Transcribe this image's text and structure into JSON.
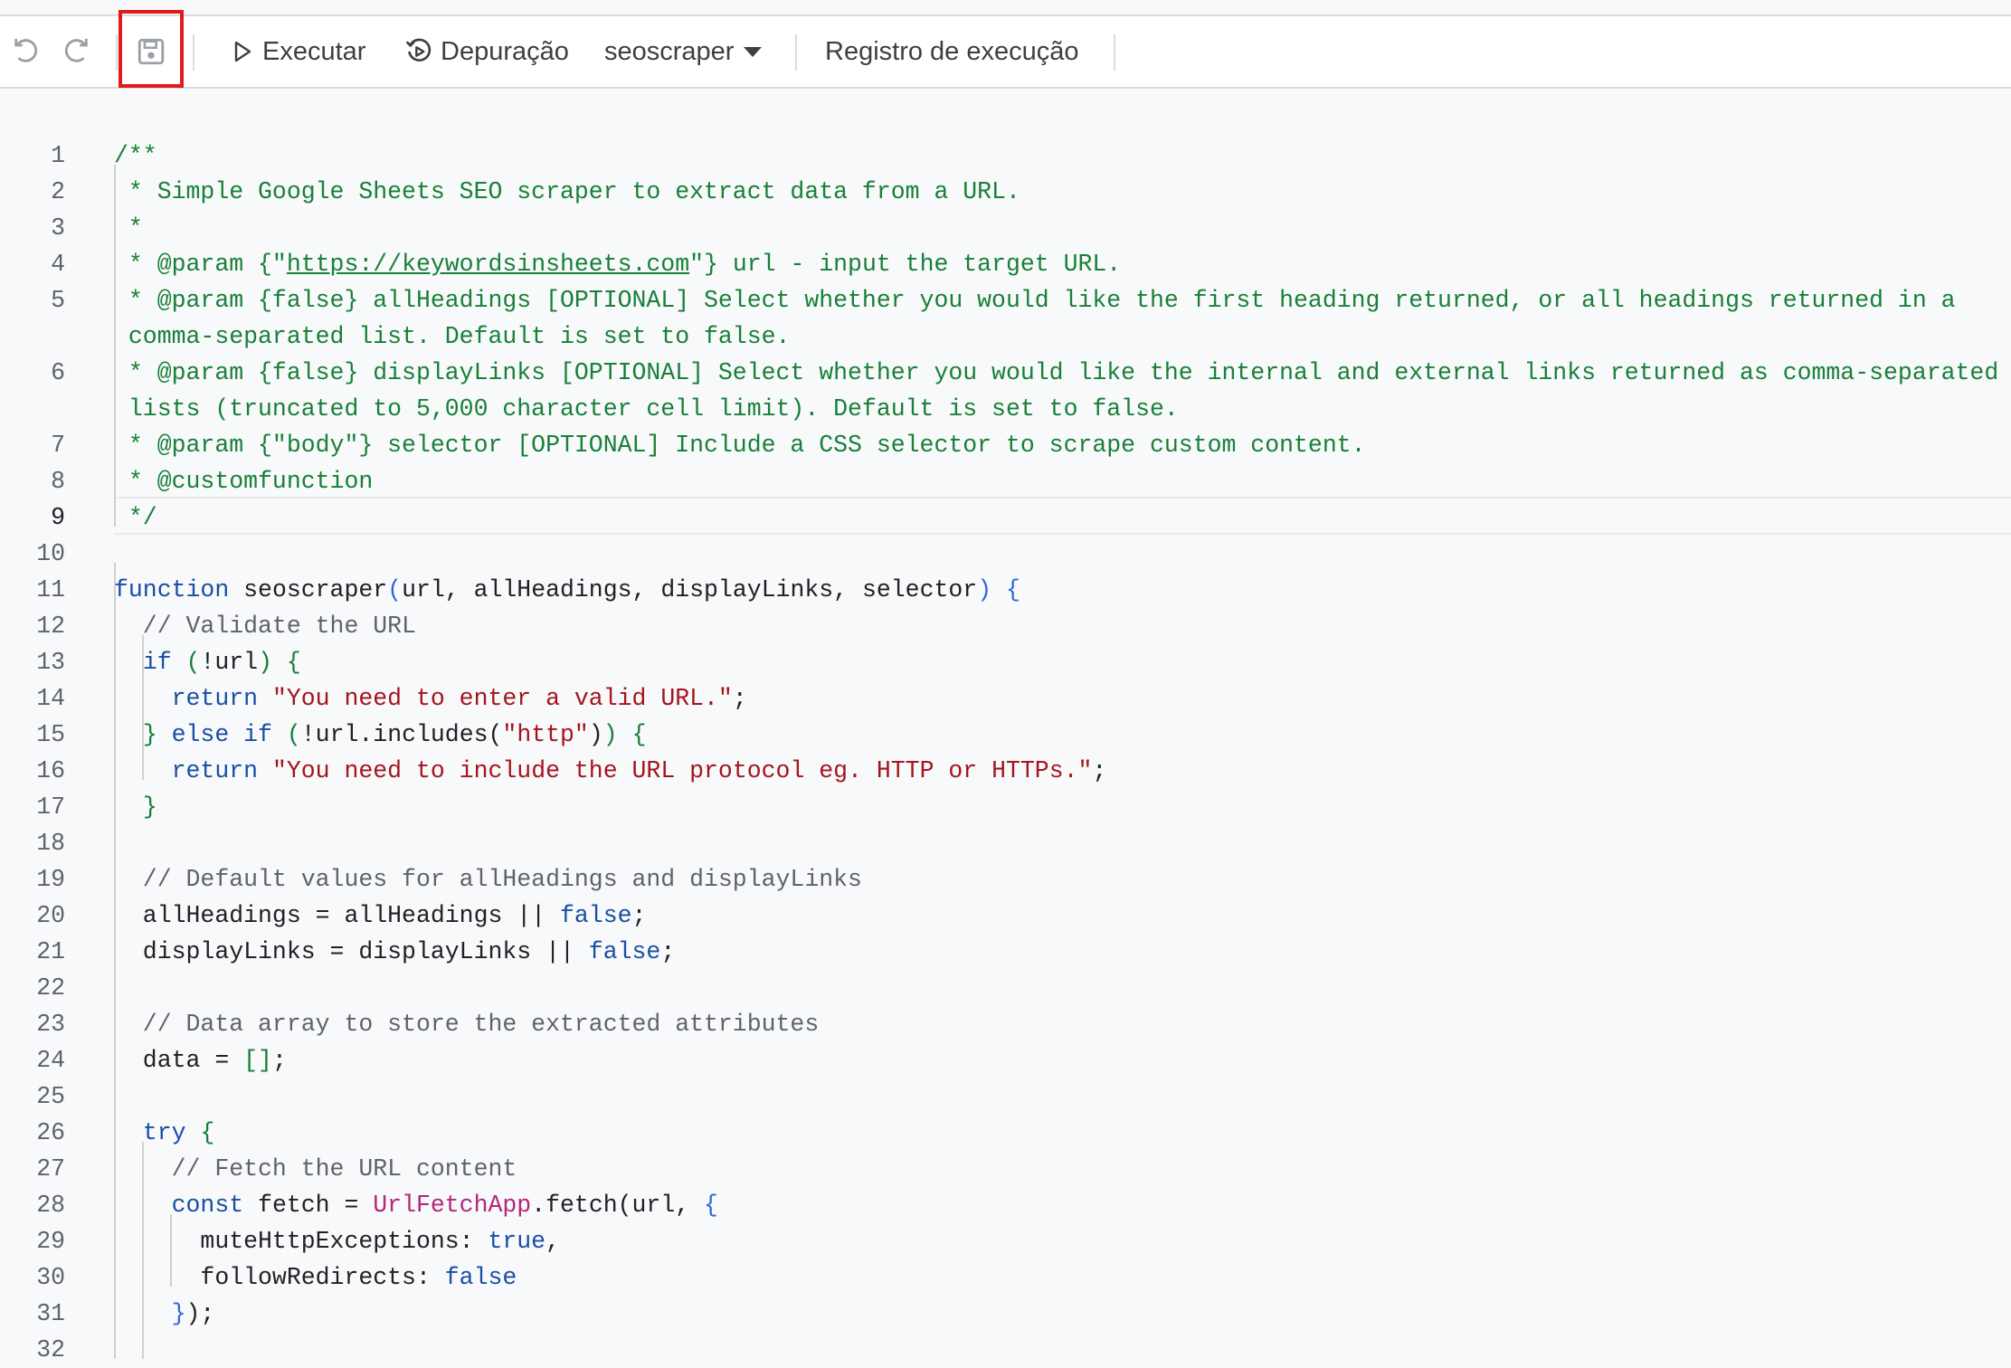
{
  "toolbar": {
    "undo_icon": "undo-icon",
    "redo_icon": "redo-icon",
    "save_icon": "save-icon",
    "run_icon": "play-icon",
    "run_label": "Executar",
    "debug_icon": "debug-icon",
    "debug_label": "Depuração",
    "function_select": {
      "value": "seoscraper",
      "icon": "caret-down-icon"
    },
    "execution_log_label": "Registro de execução"
  },
  "highlight_color": "#e21a1a",
  "editor": {
    "current_line": 9,
    "lines": [
      {
        "n": "1",
        "segs": [
          [
            "/**",
            "comment"
          ]
        ]
      },
      {
        "n": "2",
        "segs": [
          [
            " * Simple Google Sheets SEO scraper to extract data from a URL.",
            "comment"
          ]
        ]
      },
      {
        "n": "3",
        "segs": [
          [
            " *",
            "comment"
          ]
        ]
      },
      {
        "n": "4",
        "segs": [
          [
            " * @param {\"",
            "comment"
          ],
          [
            "https://keywordsinsheets.com",
            "comment-link"
          ],
          [
            "\"} url - input the target URL.",
            "comment"
          ]
        ]
      },
      {
        "n": "5",
        "segs": [
          [
            " * @param {false} allHeadings [OPTIONAL] Select whether you would like the first heading returned, or all headings returned in a",
            "comment"
          ]
        ]
      },
      {
        "n": "",
        "segs": [
          [
            " comma-separated list. Default is set to false.",
            "comment"
          ]
        ]
      },
      {
        "n": "6",
        "segs": [
          [
            " * @param {false} displayLinks [OPTIONAL] Select whether you would like the internal and external links returned as comma-separated",
            "comment"
          ]
        ]
      },
      {
        "n": "",
        "segs": [
          [
            " lists (truncated to 5,000 character cell limit). Default is set to false.",
            "comment"
          ]
        ]
      },
      {
        "n": "7",
        "segs": [
          [
            " * @param {\"body\"} selector [OPTIONAL] Include a CSS selector to scrape custom content.",
            "comment"
          ]
        ]
      },
      {
        "n": "8",
        "segs": [
          [
            " * @customfunction",
            "comment"
          ]
        ]
      },
      {
        "n": "9",
        "segs": [
          [
            " */",
            "comment"
          ]
        ]
      },
      {
        "n": "10",
        "segs": []
      },
      {
        "n": "11",
        "segs": [
          [
            "function",
            "kw"
          ],
          [
            " seoscraper",
            ""
          ],
          [
            "(",
            "br1"
          ],
          [
            "url, allHeadings, displayLinks, selector",
            ""
          ],
          [
            ")",
            "br1"
          ],
          [
            " ",
            ""
          ],
          [
            "{",
            "br1"
          ]
        ]
      },
      {
        "n": "12",
        "segs": [
          [
            "  // Validate the URL",
            "comment-sl"
          ]
        ]
      },
      {
        "n": "13",
        "segs": [
          [
            "  ",
            ""
          ],
          [
            "if",
            "kw"
          ],
          [
            " ",
            ""
          ],
          [
            "(",
            "br2"
          ],
          [
            "!url",
            ""
          ],
          [
            ")",
            "br2"
          ],
          [
            " ",
            ""
          ],
          [
            "{",
            "br2"
          ]
        ]
      },
      {
        "n": "14",
        "segs": [
          [
            "    ",
            ""
          ],
          [
            "return",
            "kw"
          ],
          [
            " ",
            ""
          ],
          [
            "\"You need to enter a valid URL.\"",
            "str"
          ],
          [
            ";",
            ""
          ]
        ]
      },
      {
        "n": "15",
        "segs": [
          [
            "  ",
            ""
          ],
          [
            "}",
            "br2"
          ],
          [
            " ",
            ""
          ],
          [
            "else",
            "kw"
          ],
          [
            " ",
            ""
          ],
          [
            "if",
            "kw"
          ],
          [
            " ",
            ""
          ],
          [
            "(",
            "br2"
          ],
          [
            "!url.includes(",
            ""
          ],
          [
            "\"http\"",
            "str"
          ],
          [
            ")",
            ""
          ],
          [
            ")",
            "br2"
          ],
          [
            " ",
            ""
          ],
          [
            "{",
            "br2"
          ]
        ]
      },
      {
        "n": "16",
        "segs": [
          [
            "    ",
            ""
          ],
          [
            "return",
            "kw"
          ],
          [
            " ",
            ""
          ],
          [
            "\"You need to include the URL protocol eg. HTTP or HTTPs.\"",
            "str"
          ],
          [
            ";",
            ""
          ]
        ]
      },
      {
        "n": "17",
        "segs": [
          [
            "  ",
            ""
          ],
          [
            "}",
            "br2"
          ]
        ]
      },
      {
        "n": "18",
        "segs": []
      },
      {
        "n": "19",
        "segs": [
          [
            "  // Default values for allHeadings and displayLinks",
            "comment-sl"
          ]
        ]
      },
      {
        "n": "20",
        "segs": [
          [
            "  allHeadings = allHeadings || ",
            ""
          ],
          [
            "false",
            "kw"
          ],
          [
            ";",
            ""
          ]
        ]
      },
      {
        "n": "21",
        "segs": [
          [
            "  displayLinks = displayLinks || ",
            ""
          ],
          [
            "false",
            "kw"
          ],
          [
            ";",
            ""
          ]
        ]
      },
      {
        "n": "22",
        "segs": []
      },
      {
        "n": "23",
        "segs": [
          [
            "  // Data array to store the extracted attributes",
            "comment-sl"
          ]
        ]
      },
      {
        "n": "24",
        "segs": [
          [
            "  data = ",
            ""
          ],
          [
            "[]",
            "br2"
          ],
          [
            ";",
            ""
          ]
        ]
      },
      {
        "n": "25",
        "segs": []
      },
      {
        "n": "26",
        "segs": [
          [
            "  ",
            ""
          ],
          [
            "try",
            "kw"
          ],
          [
            " ",
            ""
          ],
          [
            "{",
            "br2"
          ]
        ]
      },
      {
        "n": "27",
        "segs": [
          [
            "    // Fetch the URL content",
            "comment-sl"
          ]
        ]
      },
      {
        "n": "28",
        "segs": [
          [
            "    ",
            ""
          ],
          [
            "const",
            "kw"
          ],
          [
            " fetch = ",
            ""
          ],
          [
            "UrlFetchApp",
            "cls"
          ],
          [
            ".fetch(url, ",
            ""
          ],
          [
            "{",
            "br1"
          ]
        ]
      },
      {
        "n": "29",
        "segs": [
          [
            "      muteHttpExceptions: ",
            ""
          ],
          [
            "true",
            "kw"
          ],
          [
            ",",
            ""
          ]
        ]
      },
      {
        "n": "30",
        "segs": [
          [
            "      followRedirects: ",
            ""
          ],
          [
            "false",
            "kw"
          ]
        ]
      },
      {
        "n": "31",
        "segs": [
          [
            "    ",
            ""
          ],
          [
            "}",
            "br1"
          ],
          [
            ");",
            ""
          ]
        ]
      },
      {
        "n": "32",
        "segs": []
      }
    ]
  }
}
